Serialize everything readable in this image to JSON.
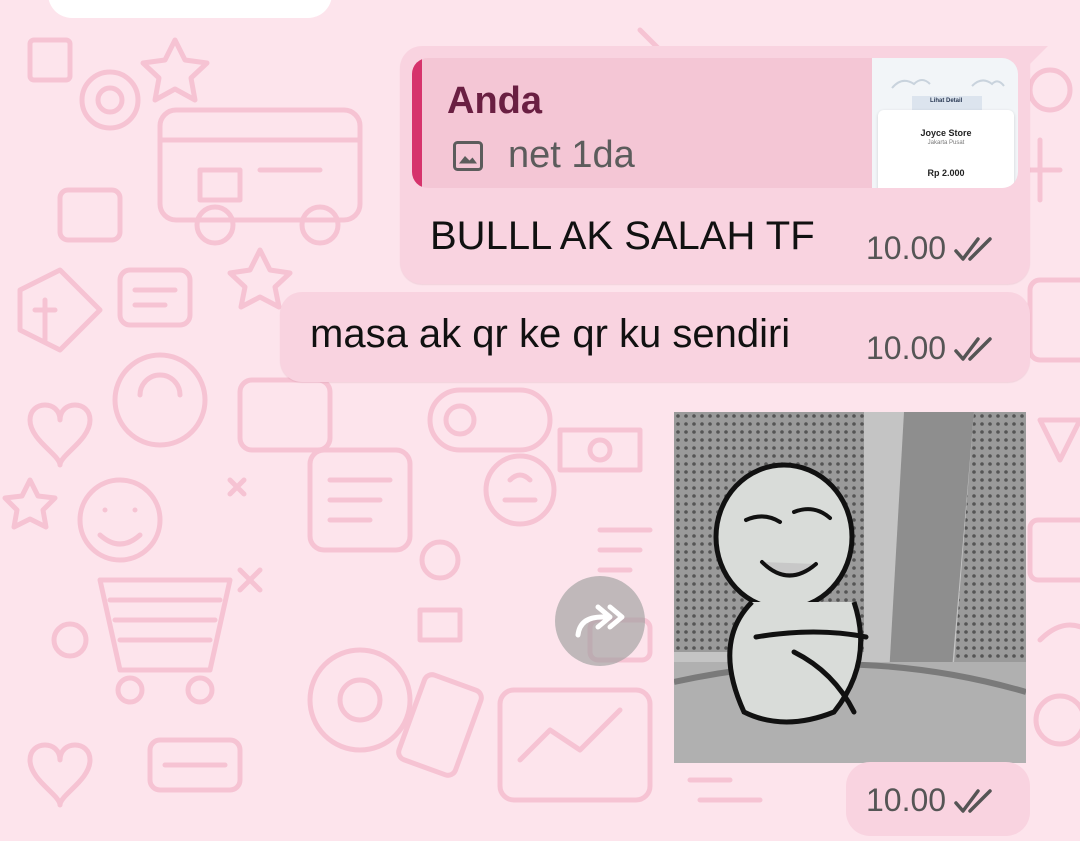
{
  "messages": [
    {
      "quote": {
        "author": "Anda",
        "icon": "image-icon",
        "text": "net 1da",
        "thumbnail": {
          "button": "Lihat Detail",
          "store": "Joyce Store",
          "city": "Jakarta Pusat",
          "amount": "Rp 2.000"
        }
      },
      "text": "BULLL AK SALAH TF",
      "time": "10.00",
      "status_icon": "double-check-icon"
    },
    {
      "text": "masa ak qr ke qr ku sendiri",
      "time": "10.00",
      "status_icon": "double-check-icon"
    },
    {
      "image": "sticker-cartoon-crouching",
      "forward_icon": "forward-icon",
      "time": "10.00",
      "status_icon": "double-check-icon"
    }
  ],
  "colors": {
    "background": "#fde4ec",
    "bubble": "#f9d3e0",
    "quote_bar": "#d6336c",
    "quote_author": "#6a1f42"
  }
}
